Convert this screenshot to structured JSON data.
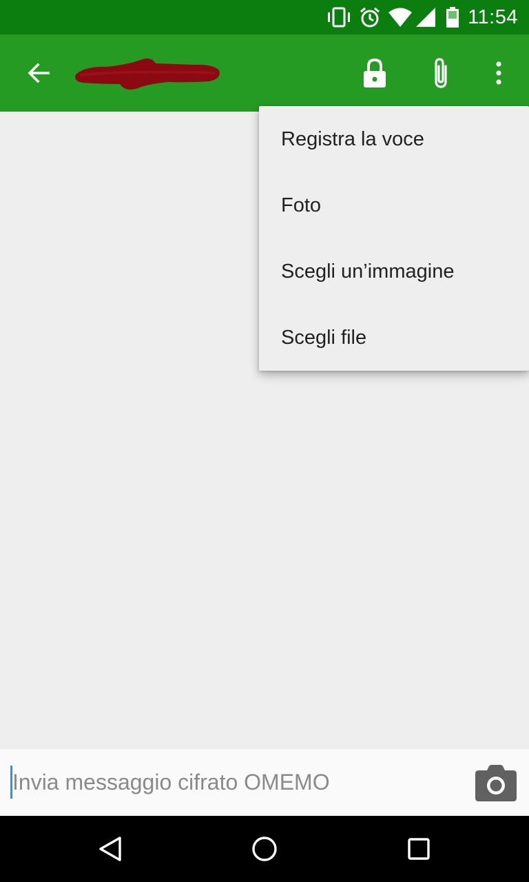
{
  "status_bar": {
    "time": "11:54",
    "icons": [
      "vibrate-icon",
      "alarm-icon",
      "wifi-icon",
      "cell-signal-icon",
      "battery-icon"
    ]
  },
  "app_bar": {
    "back_icon": "arrow-back-icon",
    "contact_name_redacted": true,
    "actions": [
      "lock-icon",
      "attach-icon",
      "more-vert-icon"
    ]
  },
  "attach_menu": {
    "items": [
      {
        "label": "Registra la voce"
      },
      {
        "label": "Foto"
      },
      {
        "label": "Scegli un’immagine"
      },
      {
        "label": "Scegli file"
      }
    ]
  },
  "composer": {
    "placeholder": "Invia messaggio cifrato OMEMO",
    "camera_icon": "camera-icon"
  },
  "nav_bar": {
    "buttons": [
      "back-triangle-icon",
      "home-circle-icon",
      "recents-square-icon"
    ]
  },
  "colors": {
    "status_bar": "#0c7d0f",
    "app_bar": "#259b24",
    "background": "#eeeeee",
    "scribble": "#8b0a12",
    "cursor": "#2196f3"
  }
}
